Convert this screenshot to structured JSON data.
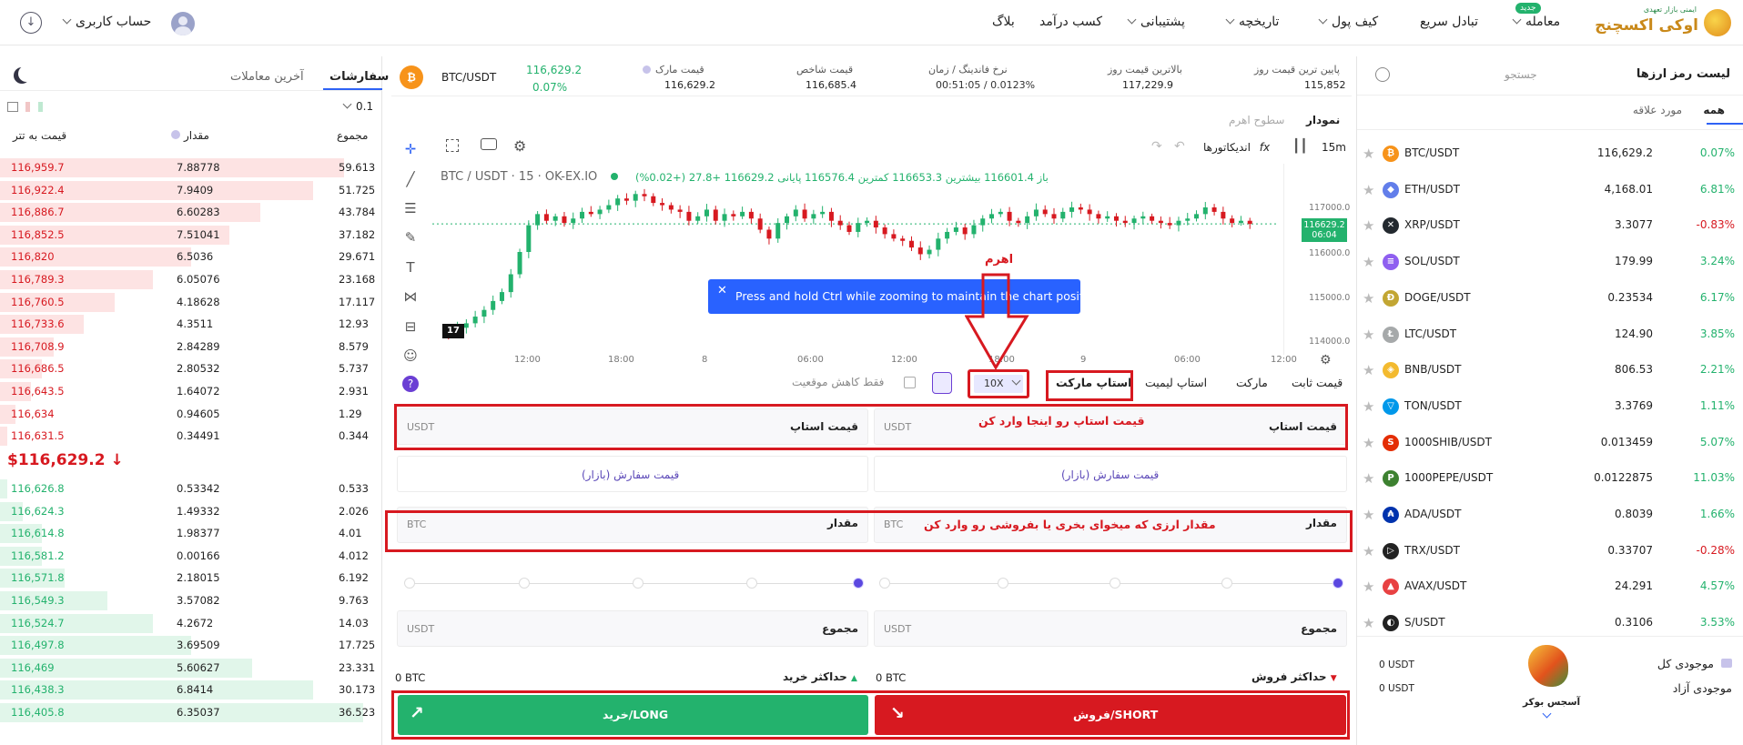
{
  "header": {
    "logo_line1": "اوکی اکسچنج",
    "logo_badge": "ایمنی بازار تعهدی",
    "nav": [
      "معامله",
      "تبادل سریع",
      "کیف پول",
      "تاریخچه",
      "پشتیبانی",
      "کسب درآمد",
      "بلاگ"
    ],
    "nav_new_badge": "جدید",
    "account_label": "حساب کاربری"
  },
  "ticker": {
    "pair": "BTC/USDT",
    "last_price": "116,629.2",
    "change_pct": "0.07%",
    "mark_label": "قیمت مارک",
    "mark_value": "116,629.2",
    "index_label": "قیمت شاخص",
    "index_value": "116,685.4",
    "funding_label": "نرخ فاندینگ / زمان",
    "funding_value": "00:51:05 / 0.0123%",
    "high_label": "بالاترین قیمت روز",
    "high_value": "117,229.9",
    "low_label": "پایین ترین قیمت روز",
    "low_value": "115,852"
  },
  "orderbook": {
    "tab_orders": "سفارشات",
    "tab_trades": "آخرین معاملات",
    "precision": "0.1",
    "col_total": "مجموع",
    "col_amount": "مقدار",
    "col_price": "قیمت به تتر",
    "asks": [
      {
        "price": "116,959.7",
        "amount": "7.88778",
        "total": "59.613",
        "depth": 0.9
      },
      {
        "price": "116,922.4",
        "amount": "7.9409",
        "total": "51.725",
        "depth": 0.82
      },
      {
        "price": "116,886.7",
        "amount": "6.60283",
        "total": "43.784",
        "depth": 0.68
      },
      {
        "price": "116,852.5",
        "amount": "7.51041",
        "total": "37.182",
        "depth": 0.6
      },
      {
        "price": "116,820",
        "amount": "6.5036",
        "total": "29.671",
        "depth": 0.5
      },
      {
        "price": "116,789.3",
        "amount": "6.05076",
        "total": "23.168",
        "depth": 0.4
      },
      {
        "price": "116,760.5",
        "amount": "4.18628",
        "total": "17.117",
        "depth": 0.3
      },
      {
        "price": "116,733.6",
        "amount": "4.3511",
        "total": "12.93",
        "depth": 0.22
      },
      {
        "price": "116,708.9",
        "amount": "2.84289",
        "total": "8.579",
        "depth": 0.14
      },
      {
        "price": "116,686.5",
        "amount": "2.80532",
        "total": "5.737",
        "depth": 0.11
      },
      {
        "price": "116,643.5",
        "amount": "1.64072",
        "total": "2.931",
        "depth": 0.08
      },
      {
        "price": "116,634",
        "amount": "0.94605",
        "total": "1.29",
        "depth": 0.04
      },
      {
        "price": "116,631.5",
        "amount": "0.34491",
        "total": "0.344",
        "depth": 0.02
      }
    ],
    "mid_price": "$116,629.2",
    "bids": [
      {
        "price": "116,626.8",
        "amount": "0.53342",
        "total": "0.533",
        "depth": 0.02
      },
      {
        "price": "116,624.3",
        "amount": "1.49332",
        "total": "2.026",
        "depth": 0.06
      },
      {
        "price": "116,614.8",
        "amount": "1.98377",
        "total": "4.01",
        "depth": 0.11
      },
      {
        "price": "116,581.2",
        "amount": "0.00166",
        "total": "4.012",
        "depth": 0.11
      },
      {
        "price": "116,571.8",
        "amount": "2.18015",
        "total": "6.192",
        "depth": 0.17
      },
      {
        "price": "116,549.3",
        "amount": "3.57082",
        "total": "9.763",
        "depth": 0.28
      },
      {
        "price": "116,524.7",
        "amount": "4.2672",
        "total": "14.03",
        "depth": 0.4
      },
      {
        "price": "116,497.8",
        "amount": "3.69509",
        "total": "17.725",
        "depth": 0.5
      },
      {
        "price": "116,469",
        "amount": "5.60627",
        "total": "23.331",
        "depth": 0.66
      },
      {
        "price": "116,438.3",
        "amount": "6.8414",
        "total": "30.173",
        "depth": 0.82
      },
      {
        "price": "116,405.8",
        "amount": "6.35037",
        "total": "36.523",
        "depth": 0.95
      }
    ]
  },
  "chart": {
    "tab_chart": "نمودار",
    "tab_leverage": "سطوح اهرم",
    "interval": "15m",
    "indicators": "اندیکاتورها",
    "legend_symbol": "BTC / USDT · 15 · OK-EX.IO",
    "legend_ohlc": "باز 116601.4 بیشترین 116653.3 کمترین 116576.4 پایانی 116629.2 +27.8 (+0.02%)",
    "price_tag": "116629.2",
    "price_tag_time": "06:04",
    "y_ticks": [
      "117000.0",
      "116000.0",
      "115000.0",
      "114000.0"
    ],
    "x_ticks": [
      "12:00",
      "18:00",
      "8",
      "06:00",
      "12:00",
      "18:00",
      "9",
      "06:00",
      "12:00"
    ],
    "toast": "Press and hold Ctrl while zooming to maintain the chart position",
    "annotation_leverage": "اهرم"
  },
  "order_form": {
    "types": [
      "قیمت ثابت",
      "مارکت",
      "استاپ لیمیت",
      "استاپ مارکت"
    ],
    "active_type": "استاپ مارکت",
    "leverage": "10X",
    "reduce_only": "فقط کاهش موقعیت",
    "stop_price_label": "قیمت استاپ",
    "stop_price_unit": "USDT",
    "stop_annotation": "قیمت استاپ رو اینجا وارد کن",
    "order_price_market": "قیمت سفارش (بازار)",
    "amount_label": "مقدار",
    "amount_unit": "BTC",
    "amount_annotation": "مقدار ارزی که میخوای بخری یا بفروشی رو وارد کن",
    "total_label": "مجموع",
    "total_unit": "USDT",
    "max_sell_label": "حداکثر فروش",
    "max_buy_label": "حداکثر خرید",
    "max_sell_value": "0 BTC",
    "max_buy_value": "0 BTC",
    "sell_button": "فروش/SHORT",
    "buy_button": "خرید/LONG"
  },
  "markets": {
    "title": "لیست رمز ارزها",
    "search_placeholder": "جستجو",
    "tab_all": "همه",
    "tab_fav": "مورد علاقه",
    "pairs": [
      {
        "pair": "BTC/USDT",
        "price": "116,629.2",
        "change": "0.07%",
        "up": true,
        "color": "#f7931a",
        "glyph": "₿"
      },
      {
        "pair": "ETH/USDT",
        "price": "4,168.01",
        "change": "6.81%",
        "up": true,
        "color": "#627eea",
        "glyph": "◆"
      },
      {
        "pair": "XRP/USDT",
        "price": "3.3077",
        "change": "-0.83%",
        "up": false,
        "color": "#23292f",
        "glyph": "✕"
      },
      {
        "pair": "SOL/USDT",
        "price": "179.99",
        "change": "3.24%",
        "up": true,
        "color": "#8f5ff0",
        "glyph": "≡"
      },
      {
        "pair": "DOGE/USDT",
        "price": "0.23534",
        "change": "6.17%",
        "up": true,
        "color": "#c2a633",
        "glyph": "Ð"
      },
      {
        "pair": "LTC/USDT",
        "price": "124.90",
        "change": "3.85%",
        "up": true,
        "color": "#a6a9aa",
        "glyph": "Ł"
      },
      {
        "pair": "BNB/USDT",
        "price": "806.53",
        "change": "2.21%",
        "up": true,
        "color": "#f3ba2f",
        "glyph": "◈"
      },
      {
        "pair": "TON/USDT",
        "price": "3.3769",
        "change": "1.11%",
        "up": true,
        "color": "#0098ea",
        "glyph": "▽"
      },
      {
        "pair": "1000SHIB/USDT",
        "price": "0.013459",
        "change": "5.07%",
        "up": true,
        "color": "#e42d04",
        "glyph": "S"
      },
      {
        "pair": "1000PEPE/USDT",
        "price": "0.0122875",
        "change": "11.03%",
        "up": true,
        "color": "#3d8130",
        "glyph": "P"
      },
      {
        "pair": "ADA/USDT",
        "price": "0.8039",
        "change": "1.66%",
        "up": true,
        "color": "#0033ad",
        "glyph": "₳"
      },
      {
        "pair": "TRX/USDT",
        "price": "0.33707",
        "change": "-0.28%",
        "up": false,
        "color": "#222",
        "glyph": "▷"
      },
      {
        "pair": "AVAX/USDT",
        "price": "24.291",
        "change": "4.57%",
        "up": true,
        "color": "#e84142",
        "glyph": "▲"
      },
      {
        "pair": "S/USDT",
        "price": "0.3106",
        "change": "3.53%",
        "up": true,
        "color": "#222",
        "glyph": "◐"
      }
    ],
    "balance_total_label": "موجودی کل",
    "balance_free_label": "موجودی آزاد",
    "balance_total_value": "0 USDT",
    "balance_free_value": "0 USDT",
    "mascot_caption": "آسجس بوکر"
  },
  "colors": {
    "accent": "#2e62f5",
    "up": "#23b26d",
    "down": "#d71920",
    "annot": "#d71920"
  }
}
